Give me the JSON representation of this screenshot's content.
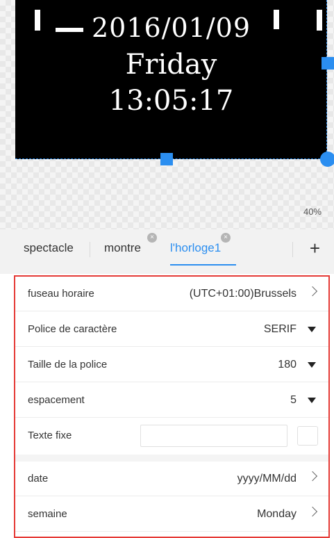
{
  "preview": {
    "date_text": "2016/01/09",
    "day_text": "Friday",
    "time_text": "13:05:17",
    "zoom": "40%"
  },
  "tabs": {
    "items": [
      {
        "label": "spectacle",
        "closable": false,
        "active": false
      },
      {
        "label": "montre",
        "closable": true,
        "active": false
      },
      {
        "label": "l'horloge1",
        "closable": true,
        "active": true
      }
    ],
    "add_label": "+"
  },
  "settings": {
    "timezone": {
      "label": "fuseau horaire",
      "value": "(UTC+01:00)Brussels"
    },
    "font": {
      "label": "Police de caractère",
      "value": "SERIF"
    },
    "font_size": {
      "label": "Taille de la police",
      "value": "180"
    },
    "spacing": {
      "label": "espacement",
      "value": "5"
    },
    "fixed_text": {
      "label": "Texte fixe",
      "value": "",
      "placeholder": ""
    },
    "date": {
      "label": "date",
      "value": "yyyy/MM/dd"
    },
    "week": {
      "label": "semaine",
      "value": "Monday"
    }
  },
  "colors": {
    "accent": "#2b8ef0",
    "panel_border": "#e53935",
    "canvas_bg": "#000000"
  }
}
